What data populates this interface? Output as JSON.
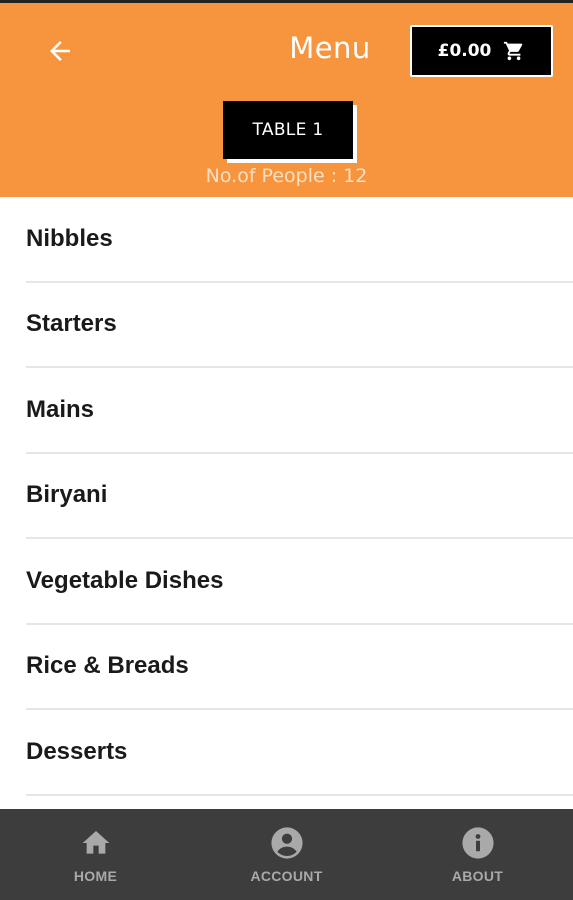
{
  "header": {
    "title": "Menu",
    "cart_total": "£0.00",
    "table_label": "TABLE 1",
    "people_text": "No.of People : 12",
    "background": "#f7943e"
  },
  "menu": {
    "categories": [
      {
        "label": "Nibbles"
      },
      {
        "label": "Starters"
      },
      {
        "label": "Mains"
      },
      {
        "label": "Biryani"
      },
      {
        "label": "Vegetable Dishes"
      },
      {
        "label": "Rice & Breads"
      },
      {
        "label": "Desserts"
      }
    ]
  },
  "bottom_nav": {
    "items": [
      {
        "label": "HOME",
        "icon": "home-icon"
      },
      {
        "label": "ACCOUNT",
        "icon": "account-icon"
      },
      {
        "label": "ABOUT",
        "icon": "info-icon"
      }
    ],
    "background": "#3d3d3d"
  }
}
